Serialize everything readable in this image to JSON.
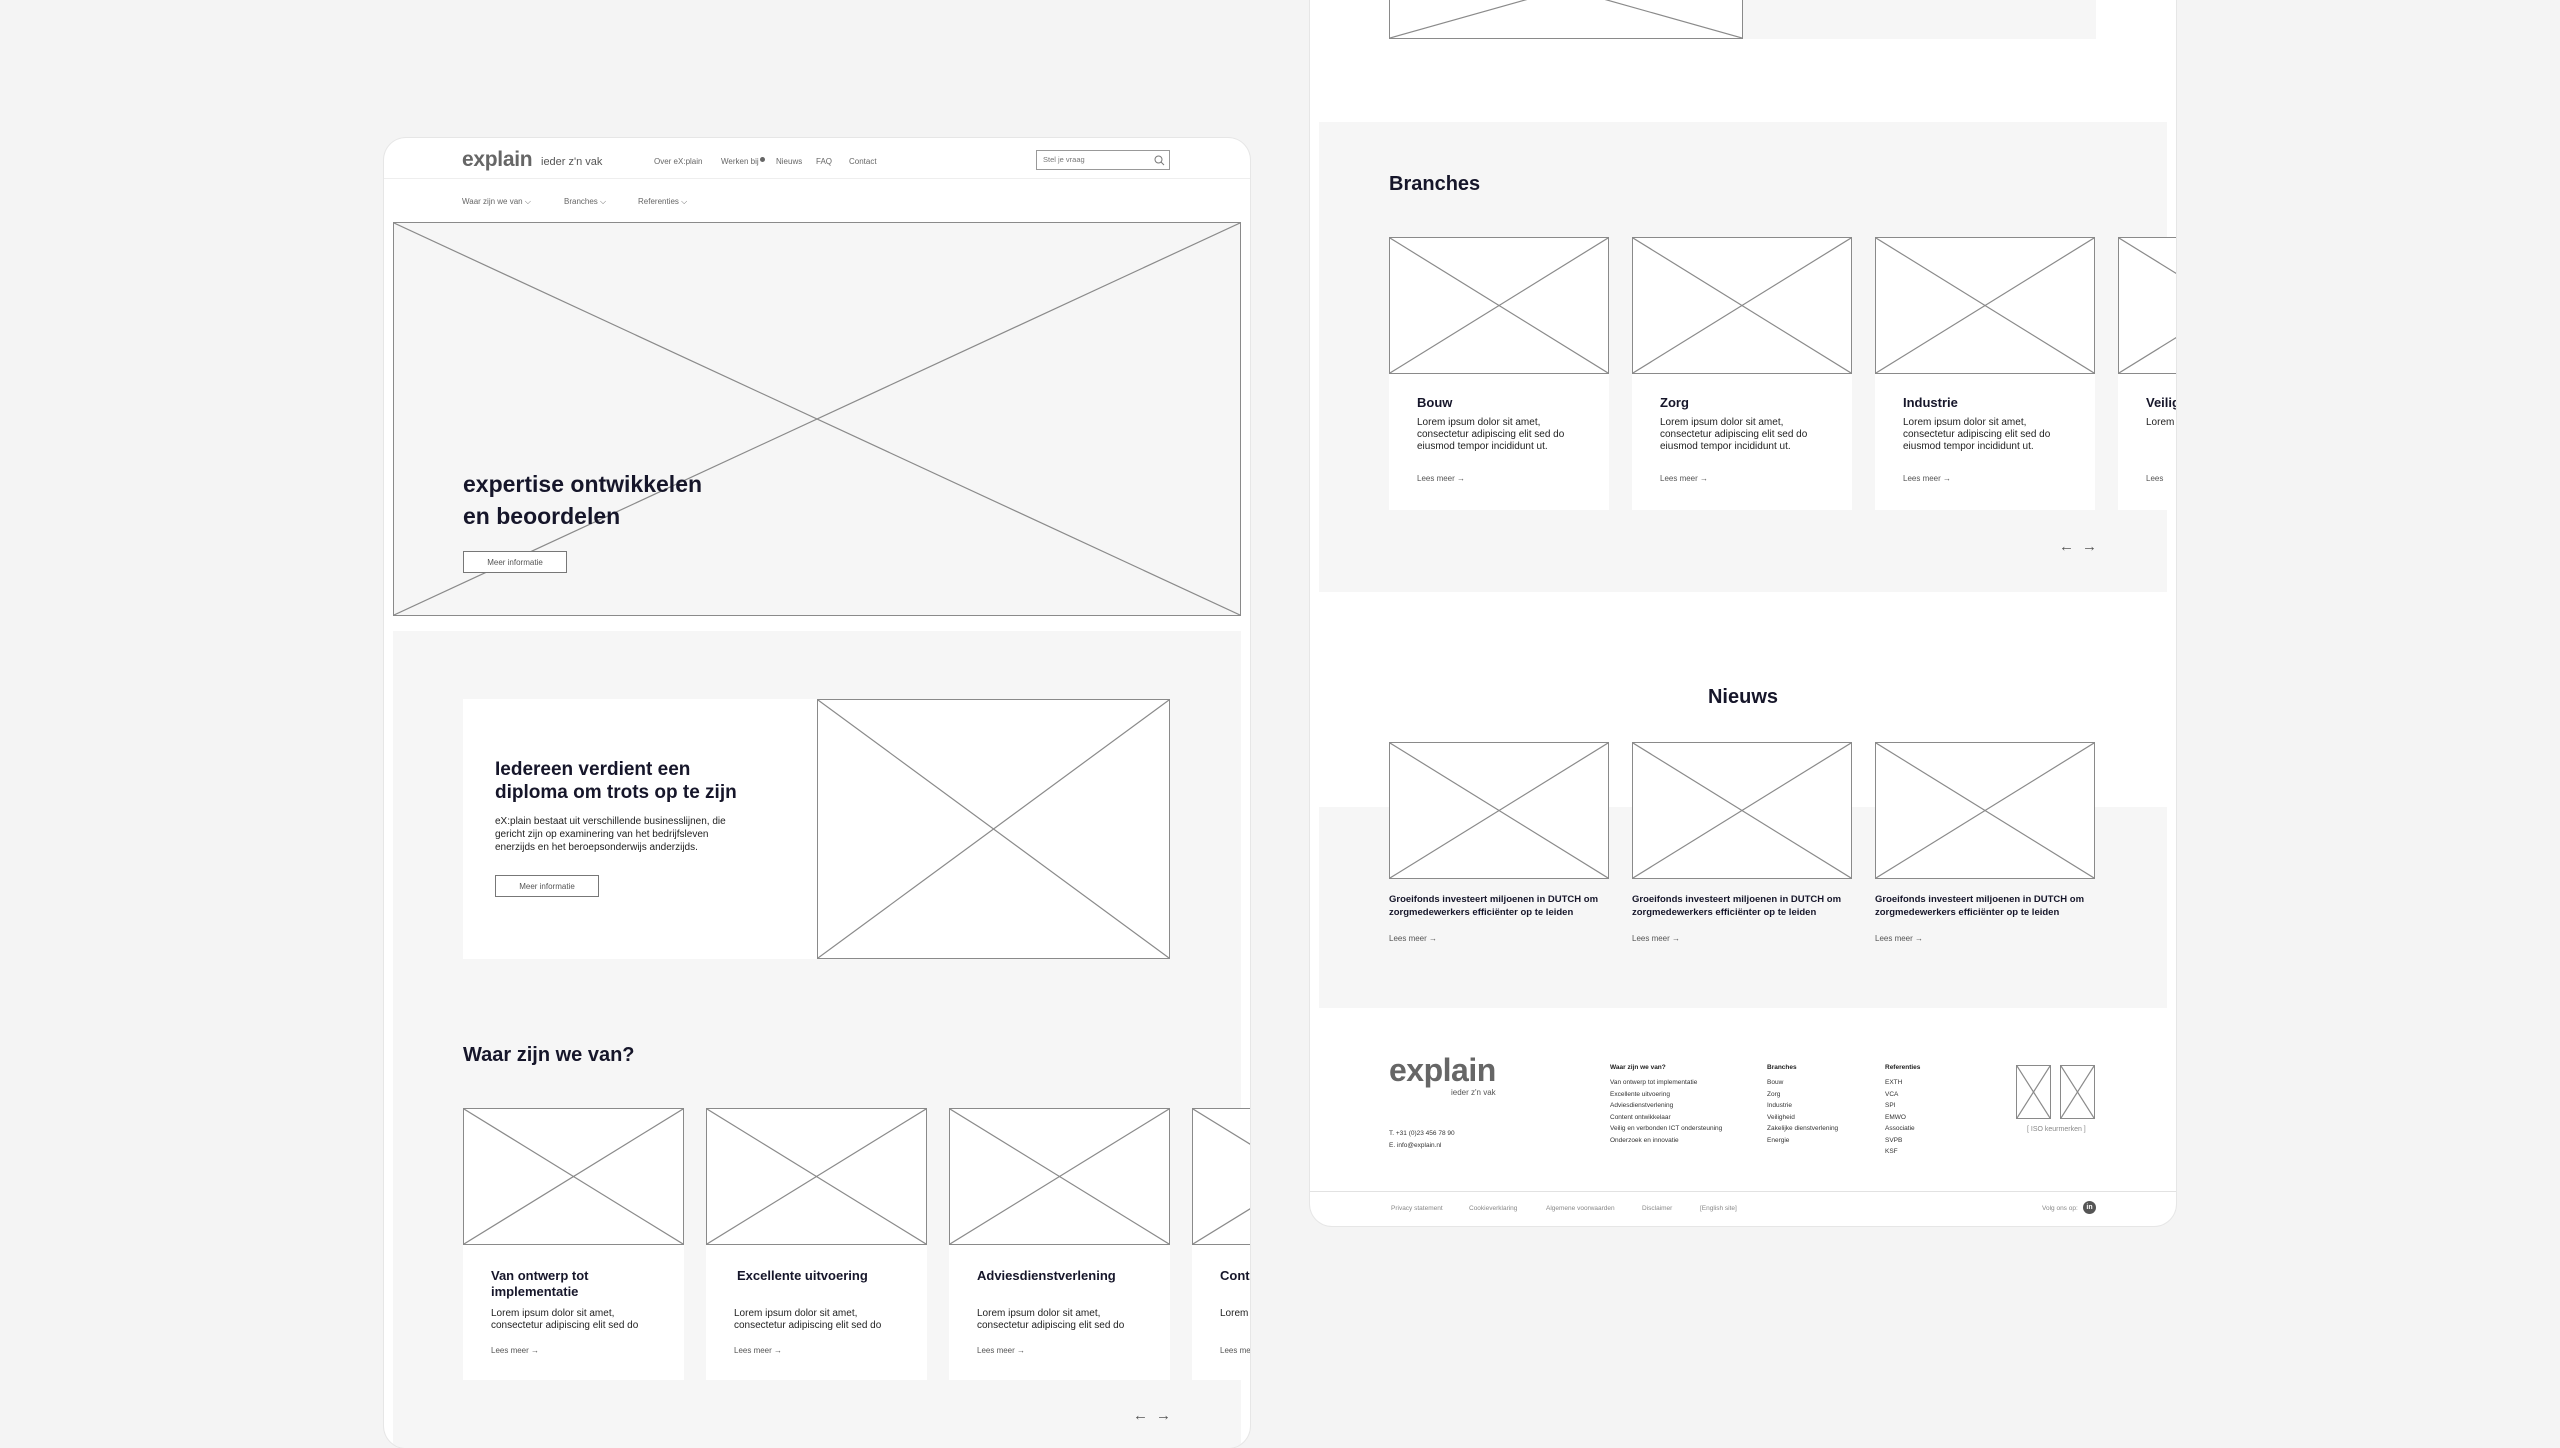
{
  "header": {
    "logo": "explain",
    "tagline": "ieder z'n vak",
    "nav": [
      "Over eX:plain",
      "Werken bij",
      "Nieuws",
      "FAQ",
      "Contact"
    ],
    "search_placeholder": "Stel je vraag",
    "subnav": [
      "Waar zijn we van",
      "Branches",
      "Referenties"
    ]
  },
  "hero": {
    "title_line1": "expertise ontwikkelen",
    "title_line2": "en beoordelen",
    "button": "Meer informatie"
  },
  "intro": {
    "title_line1": "Iedereen verdient een",
    "title_line2": "diploma om trots op te zijn",
    "body": "eX:plain bestaat uit verschillende businesslijnen, die gericht zijn op examinering van het bedrijfsleven enerzijds en het beroepsonderwijs anderzijds.",
    "button": "Meer informatie"
  },
  "services": {
    "heading": "Waar zijn we van?",
    "cards": [
      {
        "title": "Van ontwerp tot implementatie",
        "body": "Lorem ipsum dolor sit amet, consectetur adipiscing elit sed do",
        "link": "Lees meer"
      },
      {
        "title": "Excellente uitvoering",
        "body": "Lorem ipsum dolor sit amet, consectetur adipiscing elit sed do",
        "link": "Lees meer"
      },
      {
        "title": "Adviesdienstverlening",
        "body": "Lorem ipsum dolor sit amet, consectetur adipiscing elit sed do",
        "link": "Lees meer"
      },
      {
        "title": "Conte",
        "body": "Lorem",
        "link": "Lees mee"
      }
    ]
  },
  "branches": {
    "heading": "Branches",
    "cards": [
      {
        "title": "Bouw",
        "body": "Lorem ipsum dolor sit amet, consectetur adipiscing elit sed do eiusmod tempor incididunt ut.",
        "link": "Lees meer"
      },
      {
        "title": "Zorg",
        "body": "Lorem ipsum dolor sit amet, consectetur adipiscing elit sed do eiusmod tempor incididunt ut.",
        "link": "Lees meer"
      },
      {
        "title": "Industrie",
        "body": "Lorem ipsum dolor sit amet, consectetur adipiscing elit sed do eiusmod tempor incididunt ut.",
        "link": "Lees meer"
      },
      {
        "title": "Veilig",
        "body": "Lorem",
        "link": "Lees"
      }
    ]
  },
  "news": {
    "heading": "Nieuws",
    "items": [
      {
        "title": "Groeifonds investeert miljoenen in DUTCH om zorgmedewerkers efficiënter op te leiden",
        "link": "Lees meer"
      },
      {
        "title": "Groeifonds investeert miljoenen in DUTCH om zorgmedewerkers efficiënter op te leiden",
        "link": "Lees meer"
      },
      {
        "title": "Groeifonds investeert miljoenen in DUTCH om zorgmedewerkers efficiënter op te leiden",
        "link": "Lees meer"
      }
    ]
  },
  "footer": {
    "logo": "explain",
    "tagline": "ieder z'n vak",
    "phone": "T. +31 (0)23 456 78 90",
    "email": "E. info@explain.nl",
    "columns": [
      {
        "heading": "Waar zijn we van?",
        "items": [
          "Van ontwerp tot implementatie",
          "Excellente uitvoering",
          "Adviesdienstverlening",
          "Content ontwikkelaar",
          "Veilig en verbonden ICT ondersteuning",
          "Onderzoek en innovatie"
        ]
      },
      {
        "heading": "Branches",
        "items": [
          "Bouw",
          "Zorg",
          "Industrie",
          "Veiligheid",
          "Zakelijke dienstverlening",
          "Energie"
        ]
      },
      {
        "heading": "Referenties",
        "items": [
          "EXTH",
          "VCA",
          "SPI",
          "EMWO",
          "Associatie",
          "SVPB",
          "KSF"
        ]
      }
    ],
    "iso": "[ ISO keurmerken ]",
    "legal": [
      "Privacy statement",
      "Cookieverklaring",
      "Algemene voorwaarden",
      "Disclaimer",
      "[English site]"
    ],
    "follow": "Volg ons op:",
    "social_letters": "in"
  }
}
